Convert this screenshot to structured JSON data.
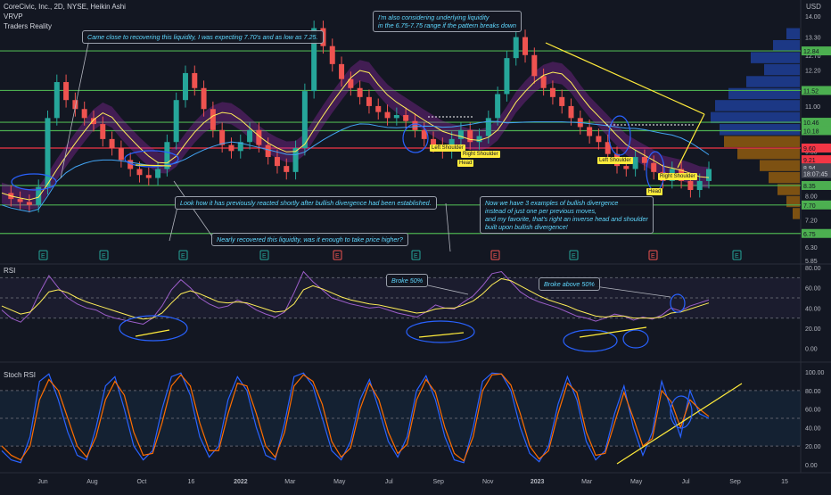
{
  "header": {
    "title": "CoreCivic, Inc., 2D, NYSE, Heikin Ashi",
    "indicator_1": "VRVP",
    "indicator_2": "Traders Reality",
    "currency": "USD"
  },
  "panes": {
    "rsi_label": "RSI",
    "stoch_label": "Stoch RSI"
  },
  "colors": {
    "background": "#131722",
    "green_level": "#4caf50",
    "red_level": "#f23645",
    "annotation_yellow": "#ffeb3b",
    "annotation_blue": "#2962ff",
    "rsi_line": "#9c5ec9",
    "stoch_k": "#2962ff",
    "stoch_d": "#ff6d00"
  },
  "annotations": [
    {
      "text": "Came close to recovering this liquidity, I was expecting 7.70's and as low as 7.25."
    },
    {
      "text": "I'm also considering underlying liquidity\nin the 6.75-7.75 range if the pattern breaks down"
    },
    {
      "text": "Look how it has previously reacted shortly after bullish divergence had been established."
    },
    {
      "text": "Nearly recovered this liquidity, was it enough to take price higher?"
    },
    {
      "text": "Now we have 3 examples of bullish divergence\ninstead of just one per previous moves,\nand my favorite, that's right an inverse head and shoulder\nbuilt upon bullish divergence!"
    },
    {
      "text": "Broke 50%"
    },
    {
      "text": "Broke above 50%"
    }
  ],
  "pattern_labels": [
    "Left Shoulder",
    "Right Shoulder",
    "Head",
    "Left Shoulder",
    "Head",
    "Right Shoulder"
  ],
  "earnings_marker": "E",
  "chart_data": [
    {
      "type": "line",
      "subtype": "heikin-ashi-candles",
      "title": "CoreCivic, Inc., 2D, NYSE, Heikin Ashi",
      "x_ticks": [
        "Jun",
        "Aug",
        "Oct",
        "16",
        "2022",
        "Mar",
        "May",
        "Jul",
        "Sep",
        "Nov",
        "2023",
        "Mar",
        "May",
        "Jul",
        "Sep",
        "15"
      ],
      "y_ticks": [
        5.85,
        6.3,
        7.2,
        8.0,
        8.7,
        9.5,
        10.4,
        11.0,
        11.6,
        12.2,
        12.7,
        13.3,
        14.0
      ],
      "y_range": [
        5.85,
        14.3
      ],
      "price_labels": {
        "levels": [
          "12.84",
          "11.52",
          "10.46",
          "10.18",
          "9.60",
          "9.21",
          "8.94",
          "18:07:45",
          "8.35",
          "7.70",
          "6.75"
        ],
        "level_colors": [
          "green",
          "green",
          "green",
          "green",
          "red",
          "red",
          "gray",
          "gray",
          "green",
          "green",
          "green"
        ],
        "current_price": "8.94",
        "countdown": "18:07:45"
      },
      "horizontal_levels": [
        12.84,
        11.52,
        10.46,
        10.18,
        9.6,
        8.35,
        7.7,
        6.75
      ],
      "close_series": [
        8.1,
        7.9,
        7.8,
        7.7,
        8.3,
        10.6,
        11.8,
        11.2,
        10.9,
        10.6,
        10.4,
        9.9,
        9.6,
        9.2,
        8.9,
        8.7,
        8.6,
        8.9,
        9.8,
        11.2,
        12.1,
        11.6,
        10.9,
        10.2,
        9.7,
        9.5,
        9.8,
        10.2,
        9.7,
        9.3,
        9.0,
        8.8,
        9.6,
        11.5,
        13.6,
        13.0,
        12.4,
        11.9,
        11.6,
        11.3,
        11.0,
        10.8,
        10.6,
        10.7,
        10.5,
        10.2,
        9.9,
        9.7,
        9.5,
        9.9,
        10.2,
        9.8,
        10.0,
        10.6,
        11.4,
        12.6,
        13.3,
        12.7,
        12.0,
        11.6,
        11.3,
        11.0,
        10.6,
        10.3,
        10.0,
        9.8,
        9.4,
        9.0,
        8.9,
        9.3,
        9.1,
        8.8,
        8.5,
        8.9,
        8.5,
        8.2,
        8.5,
        8.9
      ],
      "vrvp": {
        "bins_price": [
          13.6,
          13.2,
          12.8,
          12.4,
          12.0,
          11.6,
          11.2,
          10.8,
          10.4,
          10.0,
          9.6,
          9.2,
          8.8,
          8.4,
          8.0,
          7.6
        ],
        "bins_volume": [
          0.15,
          0.3,
          0.55,
          0.4,
          0.6,
          0.8,
          0.95,
          1.0,
          0.9,
          0.85,
          0.7,
          0.45,
          0.35,
          0.25,
          0.15,
          0.08
        ]
      }
    },
    {
      "type": "line",
      "title": "RSI",
      "y_ticks": [
        0.0,
        20.0,
        40.0,
        60.0,
        80.0
      ],
      "y_range": [
        -10,
        80
      ],
      "levels": [
        30,
        50,
        70
      ],
      "series": [
        {
          "values": [
            38,
            30,
            26,
            35,
            55,
            72,
            60,
            50,
            44,
            40,
            38,
            33,
            30,
            28,
            26,
            24,
            30,
            42,
            58,
            68,
            60,
            50,
            44,
            40,
            42,
            48,
            44,
            38,
            34,
            31,
            36,
            55,
            76,
            66,
            58,
            50,
            47,
            44,
            42,
            40,
            41,
            38,
            35,
            33,
            31,
            36,
            43,
            40,
            39,
            46,
            52,
            62,
            74,
            76,
            66,
            56,
            50,
            46,
            43,
            40,
            36,
            32,
            30,
            27,
            30,
            34,
            32,
            28,
            31,
            29,
            33,
            40,
            37,
            42,
            45,
            48
          ]
        },
        {
          "values": [
            42,
            38,
            34,
            36,
            45,
            56,
            58,
            55,
            50,
            46,
            43,
            40,
            37,
            34,
            31,
            29,
            30,
            35,
            45,
            54,
            57,
            54,
            50,
            46,
            45,
            46,
            45,
            42,
            39,
            36,
            37,
            44,
            58,
            62,
            59,
            55,
            51,
            48,
            46,
            44,
            43,
            41,
            39,
            37,
            35,
            36,
            39,
            40,
            40,
            43,
            47,
            54,
            63,
            69,
            67,
            62,
            57,
            52,
            48,
            45,
            42,
            38,
            35,
            32,
            31,
            32,
            32,
            30,
            30,
            30,
            31,
            35,
            36,
            39,
            42,
            45
          ]
        }
      ]
    },
    {
      "type": "line",
      "title": "Stoch RSI",
      "y_ticks": [
        0.0,
        20.0,
        40.0,
        60.0,
        80.0,
        100.0
      ],
      "y_range": [
        -5,
        105
      ],
      "levels": [
        20,
        50,
        80
      ],
      "series": [
        {
          "values": [
            15,
            5,
            2,
            30,
            90,
            98,
            70,
            35,
            10,
            5,
            40,
            85,
            95,
            60,
            20,
            5,
            15,
            60,
            95,
            99,
            75,
            30,
            8,
            20,
            70,
            95,
            80,
            40,
            10,
            5,
            45,
            95,
            99,
            85,
            50,
            15,
            5,
            25,
            70,
            92,
            60,
            25,
            8,
            30,
            80,
            96,
            70,
            30,
            5,
            2,
            40,
            90,
            99,
            98,
            80,
            40,
            12,
            3,
            20,
            65,
            95,
            70,
            25,
            5,
            15,
            55,
            85,
            40,
            10,
            35,
            90,
            60,
            30,
            80,
            55,
            50
          ]
        },
        {
          "values": [
            20,
            10,
            5,
            20,
            70,
            92,
            80,
            50,
            20,
            8,
            30,
            70,
            90,
            75,
            35,
            10,
            12,
            45,
            85,
            97,
            85,
            45,
            15,
            15,
            55,
            88,
            85,
            55,
            20,
            8,
            35,
            85,
            97,
            90,
            65,
            25,
            8,
            18,
            60,
            88,
            70,
            35,
            12,
            22,
            70,
            92,
            78,
            40,
            12,
            4,
            30,
            80,
            97,
            98,
            86,
            55,
            20,
            6,
            15,
            55,
            88,
            78,
            35,
            10,
            12,
            45,
            78,
            50,
            20,
            28,
            80,
            68,
            40,
            70,
            60,
            52
          ]
        }
      ]
    }
  ]
}
